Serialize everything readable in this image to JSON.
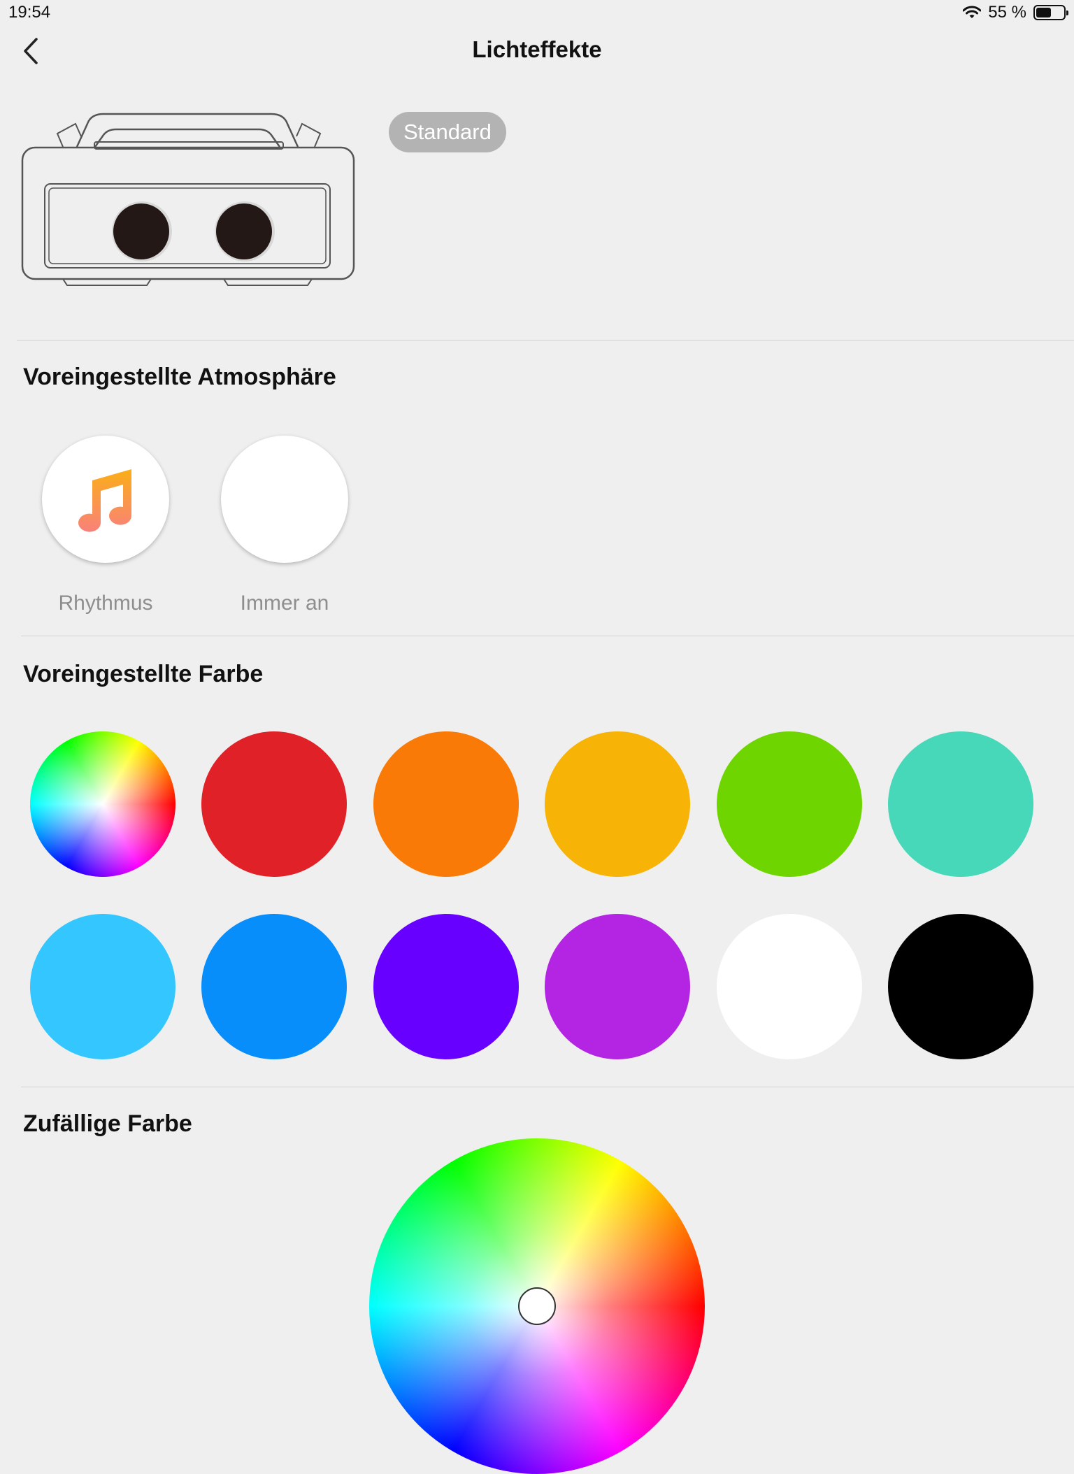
{
  "status_bar": {
    "time": "19:54",
    "battery_text": "55 %",
    "battery_level": 0.55
  },
  "nav": {
    "title": "Lichteffekte"
  },
  "device": {
    "mode_badge": "Standard"
  },
  "atmosphere": {
    "title": "Voreingestellte Atmosphäre",
    "items": [
      {
        "label": "Rhythmus",
        "icon": "music-note-icon"
      },
      {
        "label": "Immer an",
        "icon": ""
      }
    ]
  },
  "preset_colors": {
    "title": "Voreingestellte Farbe",
    "swatches": [
      "color-wheel",
      "#e02127",
      "#f97a06",
      "#f7b306",
      "#6fd501",
      "#46d8b9",
      "#33c6ff",
      "#078efb",
      "#6800ff",
      "#b424e3",
      "#ffffff",
      "#000000"
    ]
  },
  "random_color": {
    "title": "Zufällige Farbe"
  }
}
